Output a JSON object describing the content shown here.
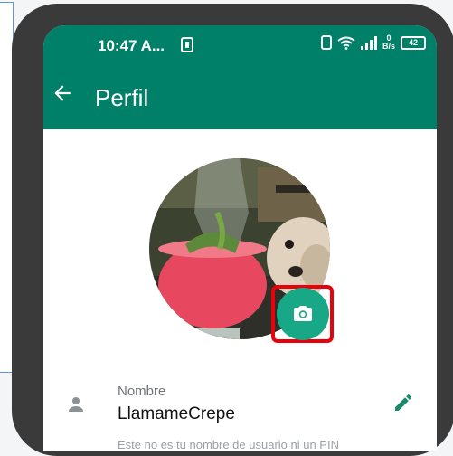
{
  "status_bar": {
    "time": "10:47 A...",
    "speed_value": "0",
    "speed_unit": "B/s",
    "battery": "42"
  },
  "header": {
    "title": "Perfil"
  },
  "profile": {
    "name_label": "Nombre",
    "name_value": "LlamameCrepe",
    "info_text": "Este no es tu nombre de usuario ni un PIN"
  },
  "colors": {
    "header_bg": "#008069",
    "accent": "#19a887",
    "highlight": "#e8000a"
  },
  "icons": [
    "back-arrow-icon",
    "camera-icon",
    "person-icon",
    "pencil-icon"
  ]
}
